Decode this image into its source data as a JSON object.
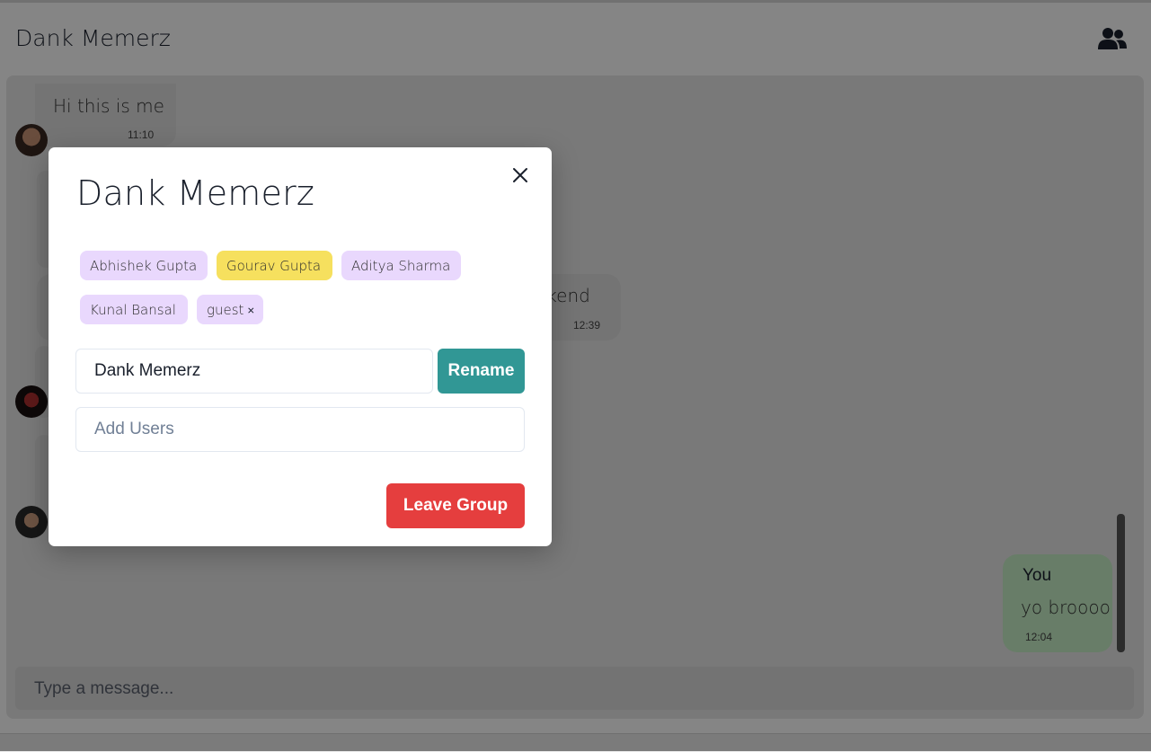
{
  "header": {
    "chat_title": "Dank Memerz",
    "group_icon": "users-icon"
  },
  "messages": [
    {
      "text": "Hi this is me",
      "time": "11:10"
    },
    {
      "text": "ekend",
      "time": "12:39"
    },
    {
      "sender": "You",
      "text": "yo broooo",
      "time": "12:04"
    }
  ],
  "composer": {
    "placeholder": "Type a message..."
  },
  "modal": {
    "title": "Dank Memerz",
    "close_icon": "close-icon",
    "members": [
      {
        "name": "Abhishek Gupta",
        "color": "#e9d8fd"
      },
      {
        "name": "Gourav Gupta",
        "color": "#f6e05e"
      },
      {
        "name": "Aditya Sharma",
        "color": "#e9d8fd"
      },
      {
        "name": "Kunal Bansal",
        "color": "#e9d8fd"
      },
      {
        "name": "guest",
        "color": "#e9d8fd"
      }
    ],
    "rename_value": "Dank Memerz",
    "rename_label": "Rename",
    "add_users_placeholder": "Add Users",
    "leave_label": "Leave Group"
  },
  "colors": {
    "rename": "#319795",
    "leave": "#e53e3e",
    "you_bubble": "#c8f0c8"
  }
}
